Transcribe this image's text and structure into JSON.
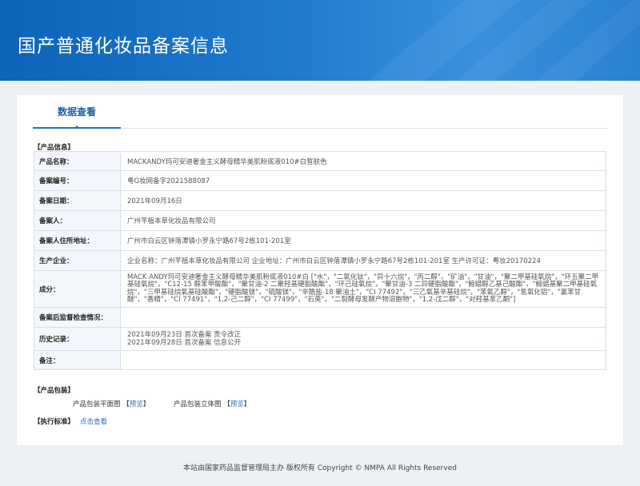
{
  "banner": {
    "title": "国产普通化妆品备案信息"
  },
  "tab": {
    "label": "数据查看"
  },
  "sections": {
    "product_info": "【产品信息】",
    "product_packaging": "【产品包装】",
    "standard": "【执行标准】"
  },
  "fields": [
    {
      "key": "产品名称：",
      "value": "MACKANDY玛可安迪奢金主义酵母精华美肌粉底液010#白皙肤色"
    },
    {
      "key": "备案编号：",
      "value": "粤G妆网备字2021588087"
    },
    {
      "key": "备案日期：",
      "value": "2021年09月16日"
    },
    {
      "key": "备案人：",
      "value": "广州芊植本草化妆品有限公司"
    },
    {
      "key": "备案人住所地址：",
      "value": "广州市白云区钟落潭镇小罗永宁路67号2栋101-201室"
    },
    {
      "key": "生产企业：",
      "value": "企业名称：广州芊植本草化妆品有限公司 企业地址：广州市白云区钟落潭镇小罗永宁路67号2栋101-201室 生产许可证：粤妆20170224"
    },
    {
      "key": "成分：",
      "value": "MACK ANDY玛可安迪奢金主义酵母精华美肌粉底液010#白 [\"水\"，\"二氧化钛\"，\"异十六烷\"，\"丙二醇\"，\"矿油\"，\"甘油\"，\"聚二甲基硅氧烷\"，\"环五聚二甲基硅氧烷\"，\"C12-15 醇苯甲酸酯\"，\"聚甘油-2 二聚羟基硬脂酸酯\"，\"环己硅氧烷\"，\"聚甘油-3 二异硬脂酸酯\"，\"鲸蜡醇乙基己酸酯\"，\"鲸蜡基聚二甲基硅氧烷\"，\"三甲基硅烷氧基硅酸酯\"，\"硬脂酸镁\"，\"硫酸镁\"，\"辛酰盐-18 聚油土\"，\"CI 77492\"，\"三乙氧基辛基硅烷\"，\"苯氧乙醇\"，\"氢氧化铝\"，\"氯苯甘醚\"，\"香精\"，\"CI 77491\"，\"1,2-己二醇\"，\"CI 77499\"，\"石英\"，\"二裂酵母发酵产物溶胞物\"，\"1,2-戊二醇\"，\"对羟基苯乙酮\"]"
    },
    {
      "key": "备案后监督检查情况：",
      "value": ""
    },
    {
      "key": "历史记录：",
      "value_lines": [
        "2021年09月23日 首次备案 责令改正",
        "2021年09月28日 首次备案 信息公开"
      ]
    },
    {
      "key": "备注：",
      "value": ""
    }
  ],
  "packaging": {
    "flat_label": "产品包装平面图",
    "flat_link": "预览",
    "solid_label": "产品包装立体图",
    "solid_link": "预览"
  },
  "standard_link": "点击查看",
  "footer": "本站由国家药品监督管理局主办 版权所有 Copyright © NMPA All Rights Reserved"
}
